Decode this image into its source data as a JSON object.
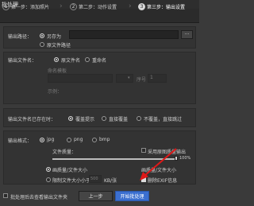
{
  "window": {
    "title": "批处理"
  },
  "steps": [
    {
      "num": "1",
      "label": "第一步：添加照片",
      "active": false
    },
    {
      "num": "2",
      "label": "第二步：动作设置",
      "active": false
    },
    {
      "num": "3",
      "label": "第三步：输出设置",
      "active": true
    }
  ],
  "output_path": {
    "label": "输出路径：",
    "option_custom": "另存为",
    "option_original": "原文件路径",
    "path_value": "",
    "browse_label": "···"
  },
  "filename": {
    "label": "输出文件名：",
    "option_original": "原文件名",
    "option_rename": "重命名",
    "template_label": "命名模板",
    "template_value": "",
    "dropdown_value": "",
    "number_label": "序号",
    "number_value": "1",
    "preview_label": "示例：",
    "preview_value": ""
  },
  "conflict": {
    "label": "输出文件名已存在时：",
    "options": [
      "覆盖提示",
      "直接覆盖",
      "不覆盖，直接跳过"
    ],
    "selected": 0
  },
  "format": {
    "label": "输出格式：",
    "options": [
      "jpg",
      "png",
      "bmp"
    ],
    "selected": 0,
    "quality_label": "文件质量：",
    "quality_percent_label": "100%",
    "quality_value": 1.0,
    "use_original_quality_label": "采用原图质量输出",
    "size_mode_label": "画质量/文件大小",
    "size_mode_options": [
      "画质量",
      "文件大小"
    ],
    "limit_label": "限制文件大小小于",
    "limit_value": "500",
    "limit_unit": "KB/张",
    "remove_exif_label": "删除EXIF信息",
    "remove_exif_checked": true
  },
  "footer": {
    "open_folder_label": "批处理后去查看输出文件夹",
    "prev_button": "上一步",
    "start_button": "开始批处理"
  },
  "colors": {
    "primary": "#3b6fd0",
    "annotation": "#e01818"
  }
}
